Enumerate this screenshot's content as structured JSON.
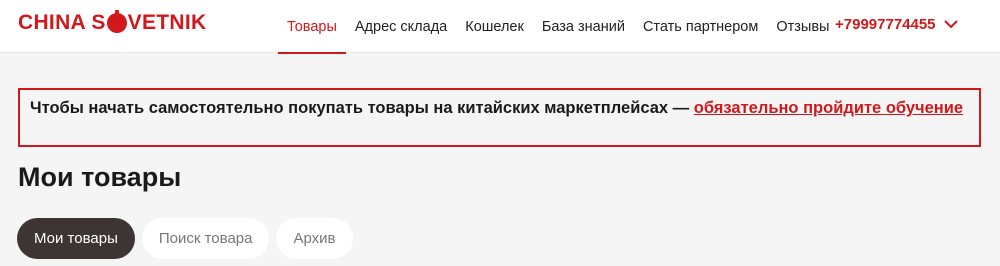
{
  "brand": {
    "logo_left": "CHINA S",
    "logo_right": "VETNIK",
    "accent_color": "#d1181b"
  },
  "nav": {
    "items": [
      {
        "label": "Товары",
        "active": true
      },
      {
        "label": "Адрес склада",
        "active": false
      },
      {
        "label": "Кошелек",
        "active": false
      },
      {
        "label": "База знаний",
        "active": false
      },
      {
        "label": "Стать партнером",
        "active": false
      },
      {
        "label": "Отзывы",
        "active": false
      }
    ],
    "phone": "+79997774455"
  },
  "notice": {
    "text": "Чтобы начать самостоятельно покупать товары на китайских маркетплейсах — ",
    "link": "обязательно пройдите обучение"
  },
  "main": {
    "title": "Мои товары",
    "tabs": [
      {
        "label": "Мои товары",
        "active": true
      },
      {
        "label": "Поиск товара",
        "active": false
      },
      {
        "label": "Архив",
        "active": false
      }
    ]
  }
}
